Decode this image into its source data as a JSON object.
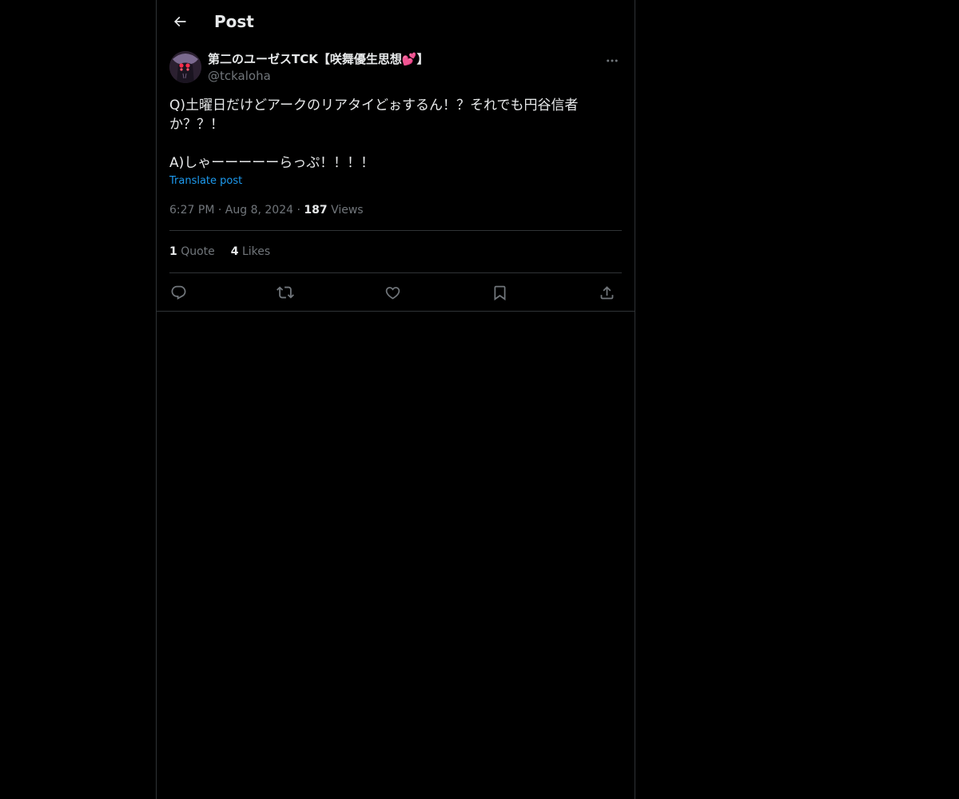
{
  "header": {
    "title": "Post"
  },
  "post": {
    "author": {
      "display_name": "第二のユーゼスTCK【咲舞優生思想💕】",
      "handle": "@tckaloha"
    },
    "text": "Q)土曜日だけどアークのリアタイどぉするん！？それでも円谷信者\nか？？！\n\nA)しゃーーーーーらっぷ！！！！",
    "translate_label": "Translate post",
    "time": "6:27 PM",
    "date": "Aug 8, 2024",
    "separator": "·",
    "views_count": "187",
    "views_label": "Views"
  },
  "stats": {
    "quotes_count": "1",
    "quotes_label": "Quote",
    "likes_count": "4",
    "likes_label": "Likes"
  },
  "colors": {
    "background": "#000000",
    "primary_text": "#e7e9ea",
    "secondary_text": "#71767b",
    "link": "#1d9bf0",
    "border": "#2f3336"
  },
  "icons": {
    "back": "arrow-left-icon",
    "more": "more-horizontal-icon",
    "reply": "reply-icon",
    "repost": "repost-icon",
    "like": "heart-icon",
    "bookmark": "bookmark-icon",
    "share": "share-icon"
  }
}
